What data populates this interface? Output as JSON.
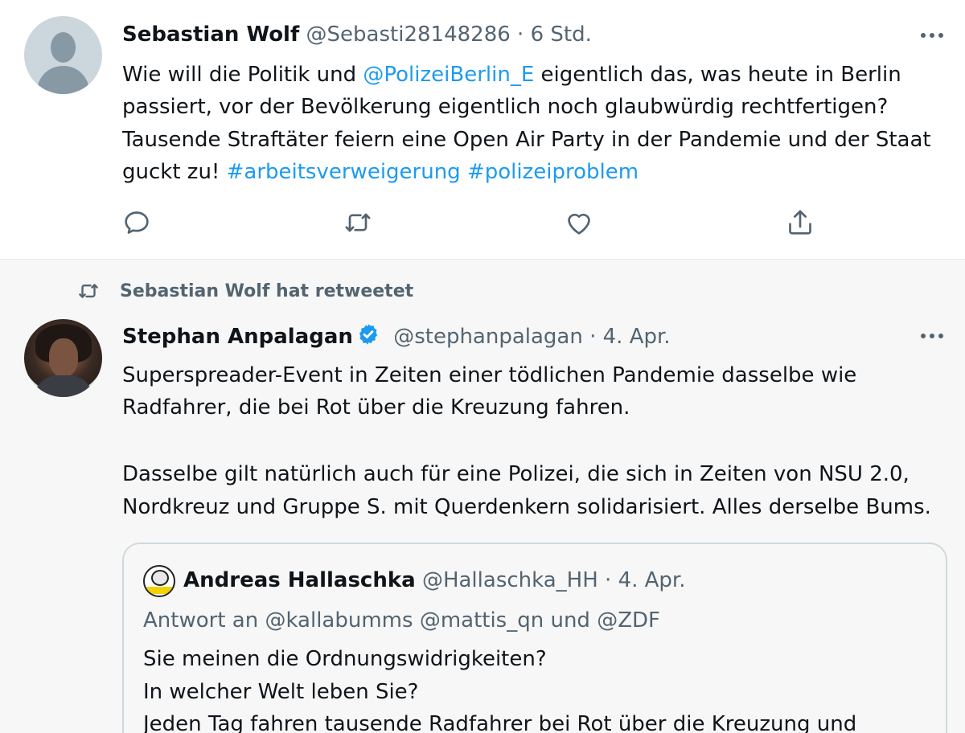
{
  "tweet1": {
    "name": "Sebastian Wolf",
    "meta": "@Sebasti28148286 · 6 Std.",
    "text_line1_pre": "Wie will die Politik und ",
    "text_line1_mention": "@PolizeiBerlin_E",
    "text_line1_post": " eigentlich das, was heute in Berlin",
    "text_line2": "passiert,  vor der Bevölkerung eigentlich noch glaubwürdig rechtfertigen?",
    "text_line3": "Tausende Straftäter feiern eine Open Air Party in der Pandemie und der Staat",
    "text_line4_pre": "guckt zu! ",
    "hashtag1": "#arbeitsverweigerung",
    "hashtag2": "#polizeiproblem",
    "actions": [
      "reply-icon",
      "retweet-icon",
      "like-icon",
      "share-icon"
    ]
  },
  "retweet_context": {
    "label": "Sebastian Wolf hat retweetet"
  },
  "tweet2": {
    "name": "Stephan Anpalagan",
    "meta": "@stephanpalagan · 4. Apr.",
    "line1": "Superspreader-Event in Zeiten einer tödlichen Pandemie dasselbe wie",
    "line2": "Radfahrer, die bei Rot über die Kreuzung fahren.",
    "line3": "Dasselbe gilt natürlich auch für eine Polizei, die sich in Zeiten von NSU 2.0,",
    "line4": "Nordkreuz und Gruppe S. mit Querdenkern solidarisiert. Alles derselbe Bums."
  },
  "quote": {
    "name": "Andreas Hallaschka",
    "meta": "@Hallaschka_HH · 4. Apr.",
    "reply_to": "Antwort an @kallabumms @mattis_qn und @ZDF",
    "line1": "Sie meinen die Ordnungswidrigkeiten?",
    "line2": "In welcher Welt leben Sie?",
    "line3": "Jeden Tag fahren tausende Radfahrer bei Rot über die Kreuzung und"
  },
  "colors": {
    "link": "#1d9bf0",
    "meta": "#536471",
    "text": "#0f1419",
    "retweeted_bg": "#f7f7f7"
  }
}
